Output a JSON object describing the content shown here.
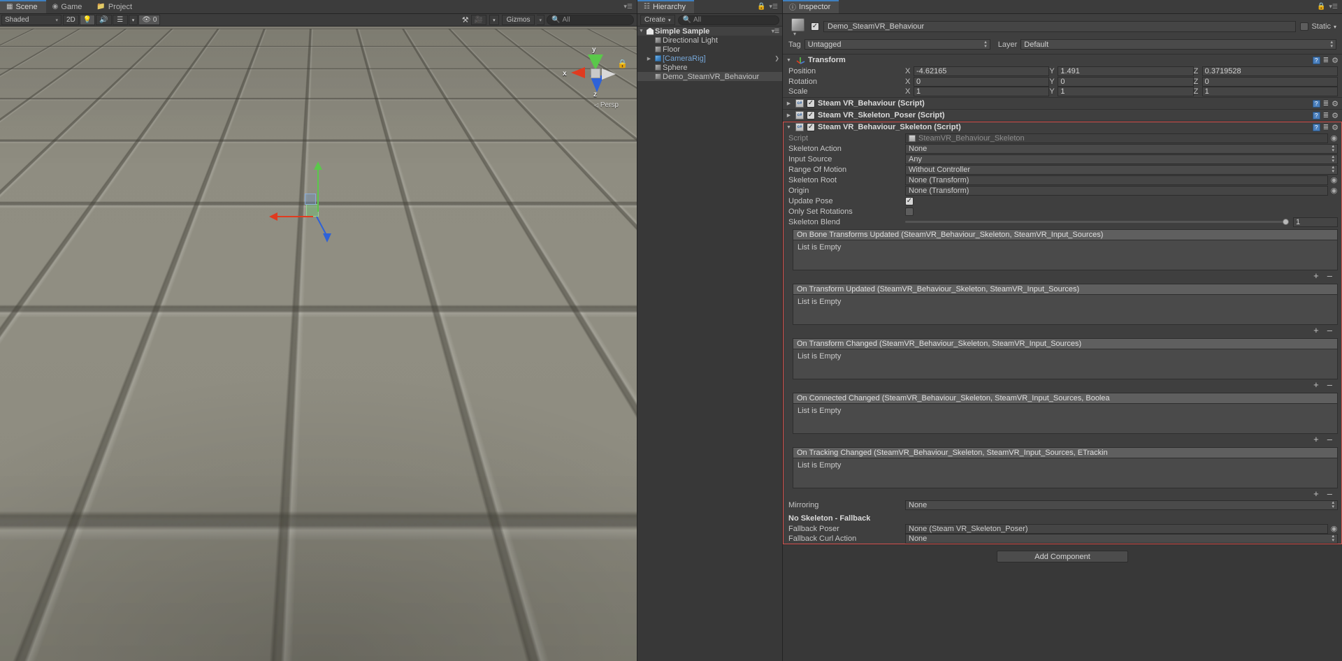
{
  "scene_panel": {
    "tabs": [
      {
        "label": "Scene",
        "icon": "grid-icon",
        "active": true
      },
      {
        "label": "Game",
        "icon": "gamepad-icon",
        "active": false
      },
      {
        "label": "Project",
        "icon": "folder-icon",
        "active": false
      }
    ],
    "toolbar": {
      "shading_mode": "Shaded",
      "mode_2d": "2D",
      "light_icon": "lightbulb-icon",
      "audio_icon": "speaker-icon",
      "fx_icon": "effects-icon",
      "hidden_count": "0",
      "hidden_icon": "eye-off-icon",
      "tools_icon": "tools-icon",
      "camera_icon": "camera-icon",
      "gizmos_label": "Gizmos",
      "search_placeholder": "All",
      "search_icon": "search-icon"
    },
    "viewport": {
      "projection_label": "Persp",
      "axis_x": "x",
      "axis_y": "y",
      "axis_z": "z",
      "lock_icon": "lock-icon",
      "colors": {
        "x_axis": "#e03b20",
        "y_axis": "#5ac84a",
        "z_axis": "#2e62d8",
        "floor": "#8d8b7f"
      }
    }
  },
  "hierarchy": {
    "tab_label": "Hierarchy",
    "tab_icon": "hierarchy-icon",
    "lock_icon": "lock-icon",
    "menu_icon": "hamburger-icon",
    "create_label": "Create",
    "search_placeholder": "All",
    "search_icon": "search-icon",
    "scene_name": "Simple Sample",
    "items": [
      {
        "label": "Directional Light",
        "icon": "gameobject-icon",
        "prefab": false,
        "expandable": false,
        "selected": false
      },
      {
        "label": "Floor",
        "icon": "gameobject-icon",
        "prefab": false,
        "expandable": false,
        "selected": false
      },
      {
        "label": "[CameraRig]",
        "icon": "prefab-icon",
        "prefab": true,
        "expandable": true,
        "selected": false
      },
      {
        "label": "Sphere",
        "icon": "gameobject-icon",
        "prefab": false,
        "expandable": false,
        "selected": false
      },
      {
        "label": "Demo_SteamVR_Behaviour",
        "icon": "gameobject-icon",
        "prefab": false,
        "expandable": false,
        "selected": true
      }
    ]
  },
  "inspector": {
    "tab_label": "Inspector",
    "tab_icon": "info-icon",
    "lock_icon": "lock-icon",
    "menu_icon": "hamburger-icon",
    "object": {
      "enabled": true,
      "name": "Demo_SteamVR_Behaviour",
      "static_label": "Static",
      "static_checked": false,
      "tag_label": "Tag",
      "tag_value": "Untagged",
      "layer_label": "Layer",
      "layer_value": "Default"
    },
    "transform": {
      "title": "Transform",
      "icon": "transform-icon",
      "rows": [
        {
          "label": "Position",
          "x": "-4.62165",
          "y": "1.491",
          "z": "0.3719528"
        },
        {
          "label": "Rotation",
          "x": "0",
          "y": "0",
          "z": "0"
        },
        {
          "label": "Scale",
          "x": "1",
          "y": "1",
          "z": "1"
        }
      ],
      "axis_labels": [
        "X",
        "Y",
        "Z"
      ]
    },
    "components": [
      {
        "title": "Steam VR_Behaviour (Script)",
        "expanded": false,
        "enabled": true
      },
      {
        "title": "Steam VR_Skeleton_Poser (Script)",
        "expanded": false,
        "enabled": true
      }
    ],
    "skeleton_component": {
      "title": "Steam VR_Behaviour_Skeleton (Script)",
      "expanded": true,
      "enabled": true,
      "script_label": "Script",
      "script_value": "SteamVR_Behaviour_Skeleton",
      "properties": [
        {
          "label": "Skeleton Action",
          "type": "popup",
          "value": "None"
        },
        {
          "label": "Input Source",
          "type": "popup",
          "value": "Any"
        },
        {
          "label": "Range Of Motion",
          "type": "popup",
          "value": "Without Controller"
        },
        {
          "label": "Skeleton Root",
          "type": "object",
          "value": "None (Transform)"
        },
        {
          "label": "Origin",
          "type": "object",
          "value": "None (Transform)"
        },
        {
          "label": "Update Pose",
          "type": "checkbox",
          "value": true
        },
        {
          "label": "Only Set Rotations",
          "type": "checkbox",
          "value": false
        },
        {
          "label": "Skeleton Blend",
          "type": "slider",
          "value": "1"
        }
      ],
      "events": [
        {
          "title": "On Bone Transforms Updated (SteamVR_Behaviour_Skeleton, SteamVR_Input_Sources)",
          "empty_text": "List is Empty"
        },
        {
          "title": "On Transform Updated (SteamVR_Behaviour_Skeleton, SteamVR_Input_Sources)",
          "empty_text": "List is Empty"
        },
        {
          "title": "On Transform Changed (SteamVR_Behaviour_Skeleton, SteamVR_Input_Sources)",
          "empty_text": "List is Empty"
        },
        {
          "title": "On Connected Changed (SteamVR_Behaviour_Skeleton, SteamVR_Input_Sources, Boolea",
          "empty_text": "List is Empty"
        },
        {
          "title": "On Tracking Changed (SteamVR_Behaviour_Skeleton, SteamVR_Input_Sources, ETrackin",
          "empty_text": "List is Empty"
        }
      ],
      "add_label": "+",
      "remove_label": "–",
      "mirroring": {
        "label": "Mirroring",
        "value": "None"
      },
      "fallback_header": "No Skeleton - Fallback",
      "fallback": [
        {
          "label": "Fallback Poser",
          "type": "object",
          "value": "None (Steam VR_Skeleton_Poser)"
        },
        {
          "label": "Fallback Curl Action",
          "type": "popup",
          "value": "None"
        }
      ]
    },
    "add_component_label": "Add Component",
    "selection_outline_color": "#d9534f"
  }
}
